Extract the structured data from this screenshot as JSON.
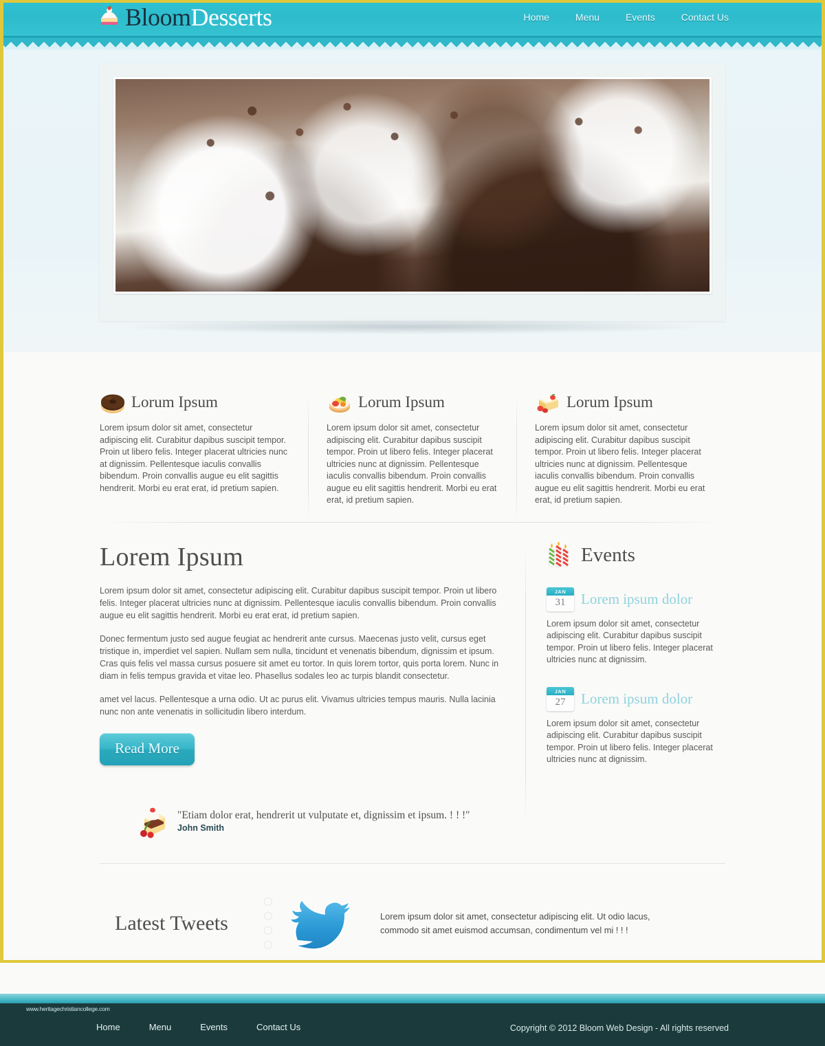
{
  "brand": {
    "name_part1": "Bloom",
    "name_part2": "Desserts",
    "logo_icon": "cake-slice-icon"
  },
  "nav": {
    "items": [
      {
        "label": "Home"
      },
      {
        "label": "Menu"
      },
      {
        "label": "Events"
      },
      {
        "label": "Contact Us"
      }
    ]
  },
  "slider": {
    "image_alt": "cupcakes-with-white-frosting-and-chocolate-pearls",
    "dots": [
      {
        "active": false
      },
      {
        "active": true
      },
      {
        "active": false
      },
      {
        "active": false
      }
    ],
    "active_index": 2,
    "total_slides": 4
  },
  "features": [
    {
      "icon": "donut-icon",
      "title": "Lorum Ipsum",
      "body": "Lorem ipsum dolor sit amet, consectetur adipiscing elit. Curabitur dapibus suscipit tempor. Proin ut libero felis. Integer placerat ultricies nunc at dignissim. Pellentesque iaculis convallis bibendum. Proin convallis augue eu elit sagittis hendrerit. Morbi eu erat erat, id pretium sapien."
    },
    {
      "icon": "fruit-tart-icon",
      "title": "Lorum Ipsum",
      "body": "Lorem ipsum dolor sit amet, consectetur adipiscing elit. Curabitur dapibus suscipit tempor. Proin ut libero felis. Integer placerat ultricies nunc at dignissim. Pellentesque iaculis convallis bibendum. Proin convallis augue eu elit sagittis hendrerit. Morbi eu erat erat, id pretium sapien."
    },
    {
      "icon": "strawberry-cake-icon",
      "title": "Lorum Ipsum",
      "body": "Lorem ipsum dolor sit amet, consectetur adipiscing elit. Curabitur dapibus suscipit tempor. Proin ut libero felis. Integer placerat ultricies nunc at dignissim. Pellentesque iaculis convallis bibendum. Proin convallis augue eu elit sagittis hendrerit. Morbi eu erat erat, id pretium sapien."
    }
  ],
  "main": {
    "title": "Lorem Ipsum",
    "paragraphs": [
      "Lorem ipsum dolor sit amet, consectetur adipiscing elit. Curabitur dapibus suscipit tempor. Proin ut libero felis. Integer placerat ultricies nunc at dignissim. Pellentesque iaculis convallis bibendum. Proin convallis augue eu elit sagittis hendrerit. Morbi eu erat erat, id pretium sapien.",
      "Donec fermentum justo sed augue feugiat ac hendrerit ante cursus. Maecenas justo velit, cursus eget tristique in, imperdiet vel sapien. Nullam sem nulla, tincidunt et venenatis bibendum, dignissim et ipsum. Cras quis felis vel massa cursus posuere sit amet eu tortor. In quis lorem tortor, quis porta lorem. Nunc in diam in felis tempus gravida et vitae leo. Phasellus sodales leo ac turpis blandit consectetur.",
      "amet vel lacus. Pellentesque a urna odio. Ut ac purus elit. Vivamus ultricies tempus mauris. Nulla lacinia nunc non ante venenatis in sollicitudin libero interdum."
    ],
    "read_more_label": "Read More",
    "testimonial": {
      "icon": "cake-slice-cherry-icon",
      "quote": "\"Etiam dolor erat, hendrerit ut vulputate et, dignissim et ipsum. ! ! !\"",
      "author": "John Smith"
    }
  },
  "events": {
    "icon": "birthday-candles-icon",
    "heading": "Events",
    "items": [
      {
        "month": "JAN",
        "day": "31",
        "title": "Lorem ipsum dolor",
        "body": "Lorem ipsum dolor sit amet, consectetur adipiscing elit. Curabitur dapibus suscipit tempor. Proin ut libero felis. Integer placerat ultricies nunc at dignissim."
      },
      {
        "month": "JAN",
        "day": "27",
        "title": "Lorem ipsum dolor",
        "body": "Lorem ipsum dolor sit amet, consectetur adipiscing elit. Curabitur dapibus suscipit tempor. Proin ut libero felis. Integer placerat ultricies nunc at dignissim."
      }
    ]
  },
  "tweets": {
    "heading": "Latest Tweets",
    "icon": "twitter-bird-icon",
    "text": "Lorem ipsum dolor sit amet, consectetur adipiscing elit. Ut odio lacus, commodo sit amet euismod accumsan, condimentum vel mi ! ! !"
  },
  "footer": {
    "watermark": "www.heritagechristiancollege.com",
    "nav": [
      {
        "label": "Home"
      },
      {
        "label": "Menu"
      },
      {
        "label": "Events"
      },
      {
        "label": "Contact Us"
      }
    ],
    "copyright": "Copyright © 2012 Bloom Web Design - All rights reserved"
  },
  "colors": {
    "header_teal": "#2fc1d2",
    "accent_teal": "#2aa9bd",
    "page_border_gold": "#e0c83c",
    "footer_dark": "#1b3a3c",
    "event_title": "#8ed3dd",
    "slider_bg": "#e9f4f8"
  }
}
